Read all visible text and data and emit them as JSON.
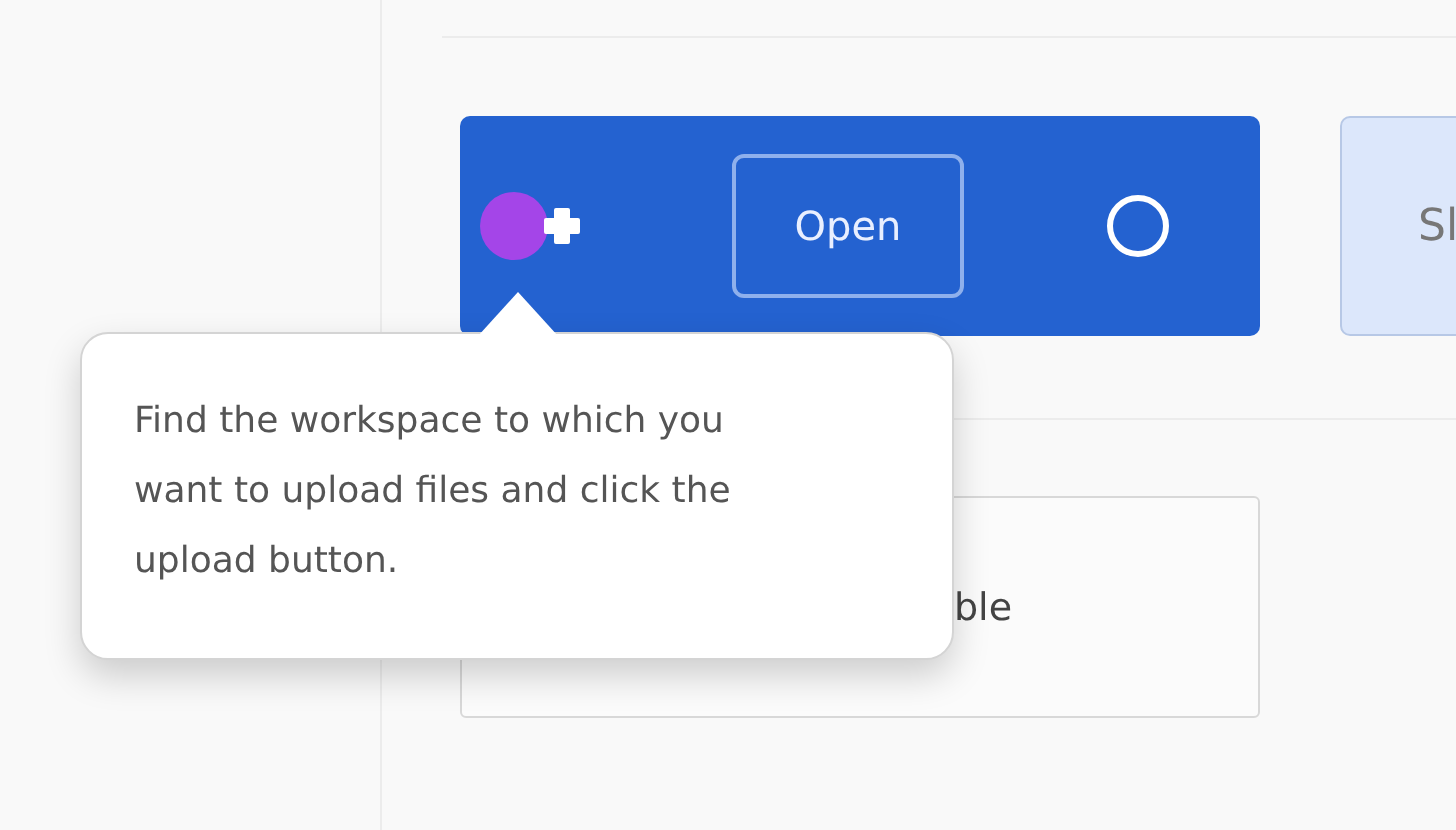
{
  "workspace_card": {
    "open_button": "Open"
  },
  "side_card": {
    "text": "Sl"
  },
  "lower_card": {
    "text": "ble"
  },
  "tooltip": {
    "text": "Find the workspace to which you want to upload files and click the upload button."
  }
}
